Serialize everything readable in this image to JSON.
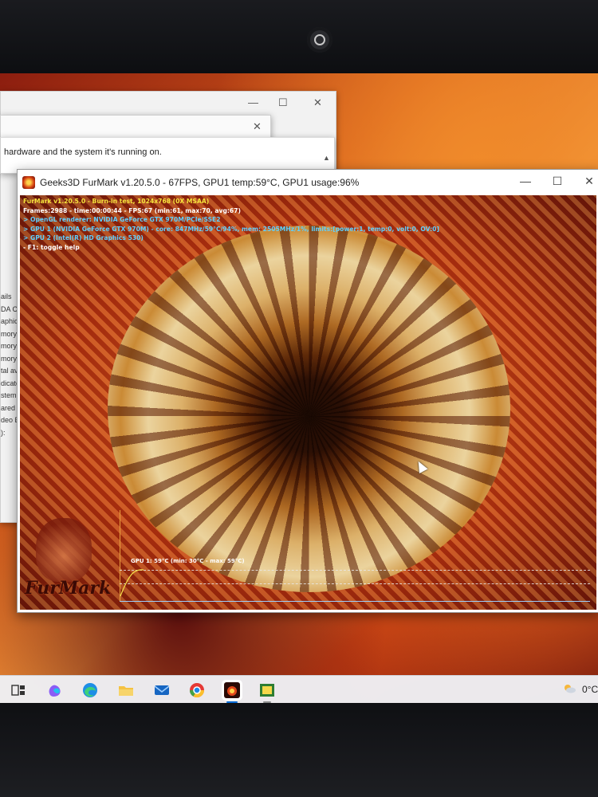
{
  "bg_window": {
    "text": "hardware and the system it's running on.",
    "side_labels": [
      "ails",
      "DA C",
      "aphics",
      "mory",
      "mory",
      "mory",
      "tal av",
      "dicate",
      "stem",
      "ared",
      "deo BI",
      "):"
    ]
  },
  "furmark_window": {
    "title": "Geeks3D FurMark v1.20.5.0 - 67FPS, GPU1 temp:59°C, GPU1 usage:96%",
    "overlay": [
      {
        "text": "FurMark v1.20.5.0 - Burn-in test, 1024x768 (0X MSAA)",
        "color": "yellow"
      },
      {
        "text": "Frames:2988 - time:00:00:44 - FPS:67 (min:61, max:70, avg:67)",
        "color": "white"
      },
      {
        "text": "> OpenGL renderer: NVIDIA GeForce GTX 970M/PCIe/SSE2",
        "color": "cyan"
      },
      {
        "text": "> GPU 1 (NVIDIA GeForce GTX 970M) - core: 847MHz/59°C/94%, mem: 2505MHz/1%, limits:[power:1, temp:0, volt:0, OV:0]",
        "color": "cyan"
      },
      {
        "text": "> GPU 2 (Intel(R) HD Graphics 530)",
        "color": "cyan"
      },
      {
        "text": "- F1: toggle help",
        "color": "white"
      }
    ],
    "temp_graph": {
      "label": "GPU 1: 59°C (min: 30°C - max: 59°C)"
    },
    "logo": "FurMark"
  },
  "taskbar": {
    "items": [
      {
        "name": "task-view",
        "icon": "task-view-icon"
      },
      {
        "name": "copilot",
        "icon": "copilot-icon"
      },
      {
        "name": "edge",
        "icon": "edge-icon"
      },
      {
        "name": "file-explorer",
        "icon": "folder-icon"
      },
      {
        "name": "mail",
        "icon": "mail-icon"
      },
      {
        "name": "chrome",
        "icon": "chrome-icon"
      },
      {
        "name": "furmark",
        "icon": "furmark-icon",
        "active": true
      },
      {
        "name": "gpu-z",
        "icon": "gpuz-icon"
      }
    ],
    "weather": "0°C"
  },
  "colors": {
    "overlay_yellow": "#f7e43c",
    "overlay_cyan": "#5fd0ff",
    "taskbar_active": "#0a6cd6"
  }
}
